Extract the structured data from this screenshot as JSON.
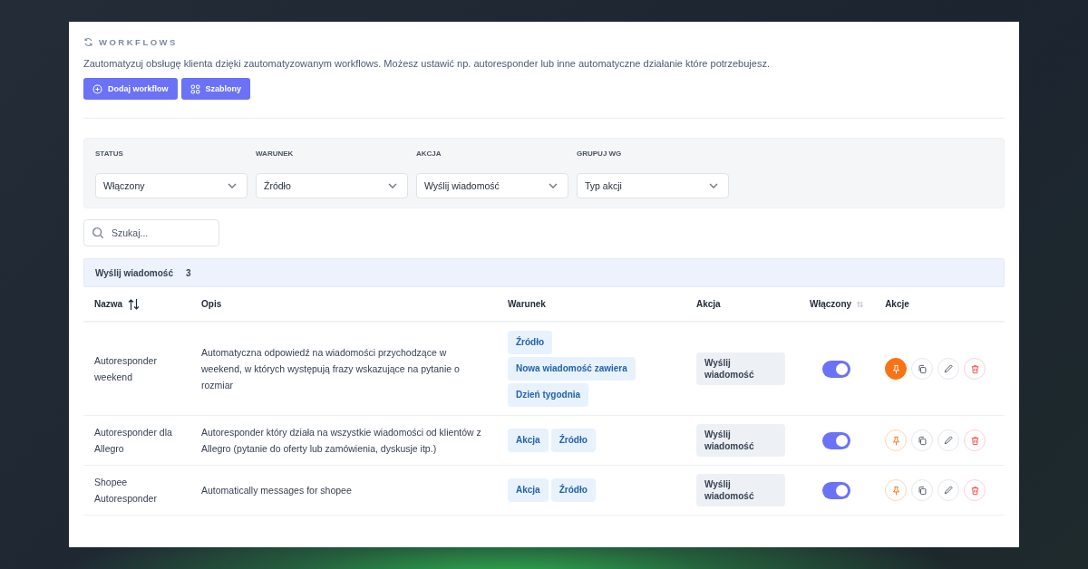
{
  "header": {
    "title": "WORKFLOWS",
    "description": "Zautomatyzuj obsługę klienta dzięki zautomatyzowanym workflows. Możesz ustawić np. autoresponder lub inne automatyczne działanie które potrzebujesz.",
    "buttons": [
      {
        "label": "Dodaj workflow",
        "kind": "add"
      },
      {
        "label": "Szablony",
        "kind": "templates"
      }
    ]
  },
  "filters": [
    {
      "label": "STATUS",
      "value": "Włączony"
    },
    {
      "label": "WARUNEK",
      "value": "Źródło"
    },
    {
      "label": "AKCJA",
      "value": "Wyślij wiadomość"
    },
    {
      "label": "GRUPUJ WG",
      "value": "Typ akcji"
    }
  ],
  "search": {
    "placeholder": "Szukaj..."
  },
  "group": {
    "name": "Wyślij wiadomość",
    "count": "3"
  },
  "table": {
    "columns": [
      {
        "label": "Nazwa",
        "sortable": true,
        "sort_muted": false
      },
      {
        "label": "Opis"
      },
      {
        "label": "Warunek"
      },
      {
        "label": "Akcja"
      },
      {
        "label": "Włączony",
        "sortable": true,
        "sort_muted": true
      },
      {
        "label": "Akcje"
      }
    ],
    "rows": [
      {
        "name": "Autoresponder weekend",
        "description": "Automatyczna odpowiedź na wiadomości przychodzące w weekend, w których występują frazy wskazujące na pytanie o rozmiar",
        "conditions": [
          "Źródło",
          "Nowa wiadomość zawiera",
          "Dzień tygodnia"
        ],
        "conditions_stacked": true,
        "action": "Wyślij wiadomość",
        "on": true,
        "pinned": true
      },
      {
        "name": "Autoresponder dla Allegro",
        "description": "Autoresponder który działa na wszystkie wiadomości od klientów z Allegro (pytanie do oferty lub zamówienia, dyskusje itp.)",
        "conditions": [
          "Akcja",
          "Źródło"
        ],
        "conditions_stacked": false,
        "action": "Wyślij wiadomość",
        "on": true,
        "pinned": false
      },
      {
        "name": "Shopee Autoresponder",
        "description": "Automatically messages for shopee",
        "conditions": [
          "Akcja",
          "Źródło"
        ],
        "conditions_stacked": false,
        "action": "Wyślij wiadomość",
        "on": true,
        "pinned": false
      }
    ]
  }
}
